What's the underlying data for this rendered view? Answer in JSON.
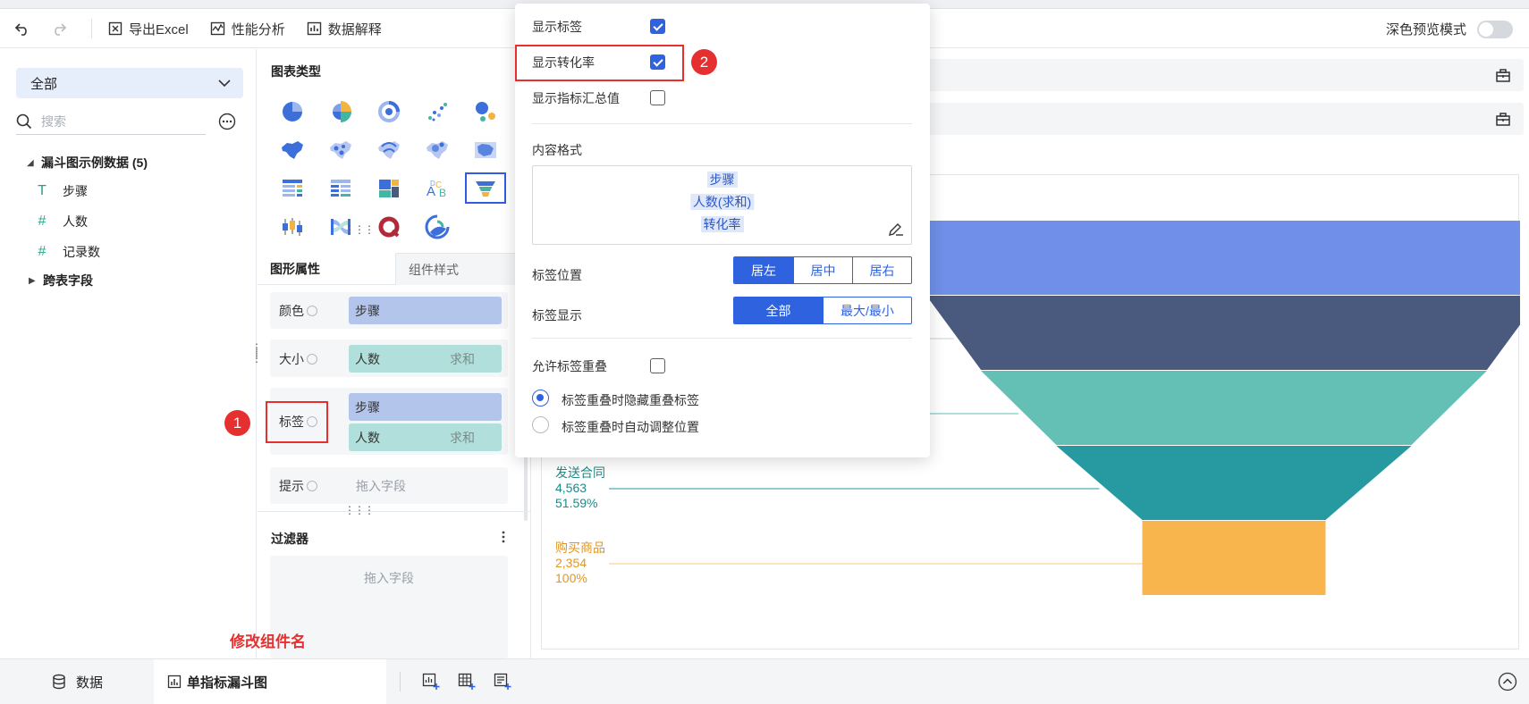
{
  "toolbar": {
    "export_excel": "导出Excel",
    "perf_analysis": "性能分析",
    "data_explain": "数据解释",
    "dark_mode": "深色预览模式"
  },
  "left": {
    "dataset": "全部",
    "search_placeholder": "搜索",
    "group": "漏斗图示例数据 (5)",
    "fields": [
      {
        "icon": "text-field-icon",
        "glyph": "T",
        "name": "步骤"
      },
      {
        "icon": "number-field-icon",
        "glyph": "#",
        "name": "人数"
      },
      {
        "icon": "count-field-icon",
        "glyph": "#",
        "name": "记录数"
      }
    ],
    "cross_fields": "跨表字段"
  },
  "config": {
    "chart_type_title": "图表类型",
    "tab_shape": "图形属性",
    "tab_component": "组件样式",
    "color_label": "颜色",
    "color_field": "步骤",
    "size_label": "大小",
    "size_field": "人数",
    "size_agg": "求和",
    "label_label": "标签",
    "label_field1": "步骤",
    "label_field2": "人数",
    "label_agg": "求和",
    "tip_label": "提示",
    "tip_hint": "拖入字段",
    "filter_title": "过滤器",
    "filter_hint": "拖入字段"
  },
  "popup": {
    "show_label": "显示标签",
    "show_label_on": true,
    "show_conversion": "显示转化率",
    "show_conversion_on": true,
    "show_total": "显示指标汇总值",
    "show_total_on": false,
    "content_format": "内容格式",
    "format_tags": [
      "步骤",
      "人数(求和)",
      "转化率"
    ],
    "label_position": "标签位置",
    "position_options": [
      "居左",
      "居中",
      "居右"
    ],
    "position_selected": 0,
    "label_display": "标签显示",
    "display_options": [
      "全部",
      "最大/最小"
    ],
    "display_selected": 0,
    "allow_overlap": "允许标签重叠",
    "allow_overlap_on": false,
    "overlap_hide": "标签重叠时隐藏重叠标签",
    "overlap_adjust": "标签重叠时自动调整位置",
    "overlap_selected": 0
  },
  "annotations": {
    "n1": "1",
    "n2": "2",
    "rename_hint": "修改组件名"
  },
  "bottom": {
    "data_tab": "数据",
    "chart_tab": "单指标漏斗图"
  },
  "chart_data": {
    "type": "funnel",
    "stages": [
      {
        "value": 8845,
        "color": "#6f8fe8"
      },
      {
        "value": 7900,
        "color": "#4a5a7e"
      },
      {
        "value": 6500,
        "color": "#64bfb4"
      },
      {
        "value": 4563,
        "color": "#2799a1"
      },
      {
        "value": 2354,
        "color": "#f8b54d"
      }
    ],
    "visible_labels": [
      {
        "stage": 3,
        "name": "发送合同",
        "value": "4,563",
        "rate": "51.59%",
        "color": "#1e8a86"
      },
      {
        "stage": 4,
        "name": "购买商品",
        "value": "2,354",
        "rate": "100%",
        "color": "#e09622"
      }
    ]
  }
}
